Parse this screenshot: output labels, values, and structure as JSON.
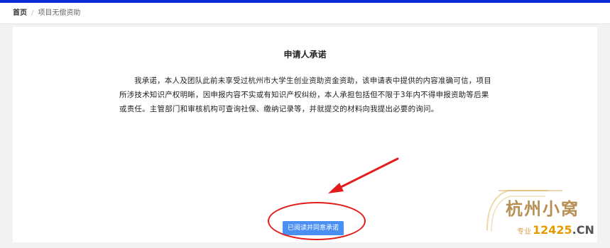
{
  "breadcrumb": {
    "home": "首页",
    "separator": "/",
    "current": "项目无偿资助"
  },
  "pledge": {
    "title": "申请人承诺",
    "body": "我承诺，本人及团队此前未享受过杭州市大学生创业资助资金资助，该申请表中提供的内容准确可信，项目所涉技术知识产权明晰，因申报内容不实或有知识产权纠纷，本人承担包括但不限于3年内不得申报资助等后果或责任。主管部门和审核机构可查询社保、缴纳记录等，并就提交的材料向我提出必要的询问。",
    "agree_button": "已阅读并同意承诺"
  },
  "watermark": {
    "title": "杭州小窝",
    "site_prefix": "专业",
    "site_number": "12425",
    "site_tld": ".CN"
  },
  "colors": {
    "accent": "#0a2bd6",
    "button": "#4a8ff2",
    "annotation": "#e31b1b"
  }
}
